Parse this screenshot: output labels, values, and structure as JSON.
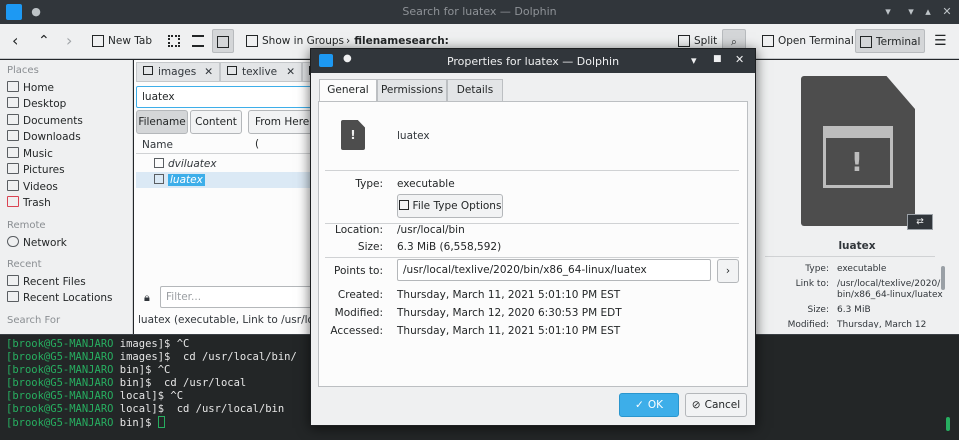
{
  "window": {
    "title": "Search for luatex — Dolphin"
  },
  "toolbar": {
    "new_tab": "New Tab",
    "show_in_groups": "Show in Groups",
    "breadcrumb": "filenamesearch:",
    "split": "Split",
    "open_terminal": "Open Terminal",
    "terminal": "Terminal"
  },
  "sidebar": {
    "places_head": "Places",
    "places": [
      "Home",
      "Desktop",
      "Documents",
      "Downloads",
      "Music",
      "Pictures",
      "Videos",
      "Trash"
    ],
    "remote_head": "Remote",
    "remote": [
      "Network"
    ],
    "recent_head": "Recent",
    "recent": [
      "Recent Files",
      "Recent Locations"
    ],
    "search_head": "Search For"
  },
  "center": {
    "tabs": [
      "images",
      "texlive"
    ],
    "search_value": "luatex",
    "filter_buttons": [
      "Filename",
      "Content",
      "From Here ("
    ],
    "column_name": "Name",
    "files": [
      "dviluatex",
      "luatex"
    ],
    "filter_placeholder": "Filter...",
    "status": "luatex (executable, Link to /usr/local/te"
  },
  "dialog": {
    "title": "Properties for luatex — Dolphin",
    "tabs": [
      "General",
      "Permissions",
      "Details"
    ],
    "name": "luatex",
    "type_label": "Type:",
    "type_value": "executable",
    "file_type_options": "File Type Options",
    "location_label": "Location:",
    "location_value": "/usr/local/bin",
    "size_label": "Size:",
    "size_value": "6.3 MiB (6,558,592)",
    "points_to_label": "Points to:",
    "points_to_value": "/usr/local/texlive/2020/bin/x86_64-linux/luatex",
    "created_label": "Created:",
    "created_value": "Thursday, March 11, 2021 5:01:10 PM EST",
    "modified_label": "Modified:",
    "modified_value": "Thursday, March 12, 2020 6:30:53 PM EDT",
    "accessed_label": "Accessed:",
    "accessed_value": "Thursday, March 11, 2021 5:01:10 PM EST",
    "ok": "OK",
    "cancel": "Cancel"
  },
  "info_panel": {
    "name": "luatex",
    "type_label": "Type:",
    "type_value": "executable",
    "link_label": "Link to:",
    "link_value_1": "/usr/local/texlive/2020/",
    "link_value_2": "bin/x86_64-linux/luatex",
    "size_label": "Size:",
    "size_value": "6.3 MiB",
    "modified_label": "Modified:",
    "modified_value": "Thursday, March 12"
  },
  "terminal": {
    "lines": [
      {
        "prompt": "[brook@G5-MANJARO",
        "dir": " images",
        "rest": "]$ ^C"
      },
      {
        "prompt": "[brook@G5-MANJARO",
        "dir": " images",
        "rest": "]$  cd /usr/local/bin/"
      },
      {
        "prompt": "[brook@G5-MANJARO",
        "dir": " bin",
        "rest": "]$ ^C"
      },
      {
        "prompt": "[brook@G5-MANJARO",
        "dir": " bin",
        "rest": "]$  cd /usr/local"
      },
      {
        "prompt": "[brook@G5-MANJARO",
        "dir": " local",
        "rest": "]$ ^C"
      },
      {
        "prompt": "[brook@G5-MANJARO",
        "dir": " local",
        "rest": "]$  cd /usr/local/bin"
      },
      {
        "prompt": "[brook@G5-MANJARO",
        "dir": " bin",
        "rest": "]$ "
      }
    ]
  },
  "colors": {
    "accent": "#3daee9",
    "titlebar": "#31363b",
    "terminal_bg": "#232627",
    "prompt_green": "#27ae60"
  }
}
